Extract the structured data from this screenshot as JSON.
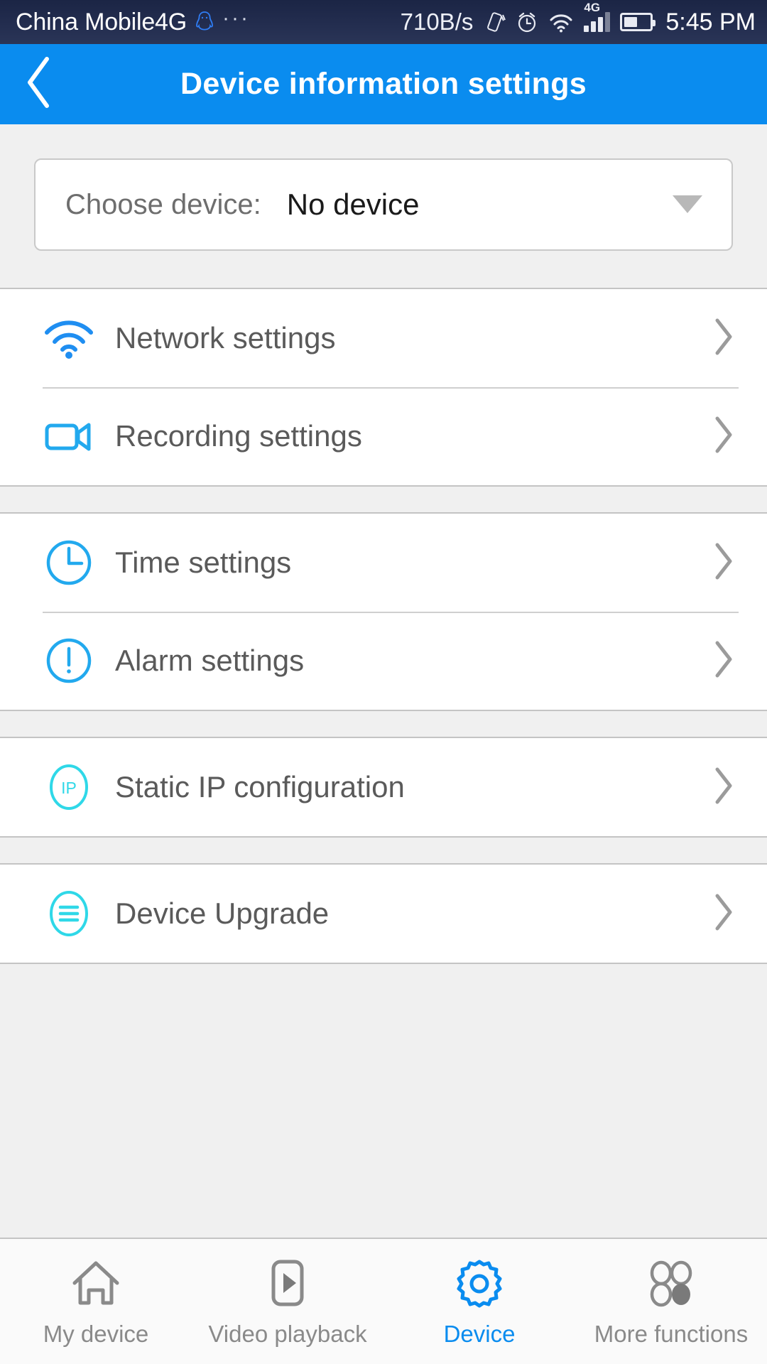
{
  "status_bar": {
    "carrier": "China Mobile4G",
    "qq_icon": "qq-penguin-icon",
    "overflow_dots": "···",
    "network_speed": "710B/s",
    "icons": [
      "vibrate-icon",
      "alarm-clock-icon",
      "wifi-icon",
      "signal-4g-icon",
      "battery-icon"
    ],
    "signal_label": "4G",
    "time": "5:45 PM"
  },
  "header": {
    "back_icon": "chevron-left-icon",
    "title": "Device information settings"
  },
  "device_select": {
    "label": "Choose device:",
    "value": "No device",
    "caret_icon": "triangle-down-icon"
  },
  "groups": [
    {
      "items": [
        {
          "icon": "wifi-icon",
          "label": "Network settings",
          "chevron": "chevron-right-icon"
        },
        {
          "icon": "camcorder-icon",
          "label": "Recording settings",
          "chevron": "chevron-right-icon"
        }
      ]
    },
    {
      "items": [
        {
          "icon": "clock-icon",
          "label": "Time settings",
          "chevron": "chevron-right-icon"
        },
        {
          "icon": "exclamation-circle-icon",
          "label": "Alarm settings",
          "chevron": "chevron-right-icon"
        }
      ]
    },
    {
      "items": [
        {
          "icon": "ip-circle-icon",
          "label": "Static IP configuration",
          "chevron": "chevron-right-icon"
        }
      ]
    },
    {
      "items": [
        {
          "icon": "list-circle-icon",
          "label": "Device Upgrade",
          "chevron": "chevron-right-icon"
        }
      ]
    }
  ],
  "bottom_nav": {
    "items": [
      {
        "icon": "home-icon",
        "label": "My device",
        "active": false
      },
      {
        "icon": "play-box-icon",
        "label": "Video playback",
        "active": false
      },
      {
        "icon": "gear-icon",
        "label": "Device",
        "active": true
      },
      {
        "icon": "four-circles-icon",
        "label": "More functions",
        "active": false
      }
    ]
  },
  "colors": {
    "header_blue": "#0a8cef",
    "accent_blue": "#1a9ae8",
    "icon_cyan": "#2fd8e8",
    "page_bg": "#f0f0f0",
    "status_bg": "#232d4f",
    "text_gray": "#5a5a5a"
  }
}
